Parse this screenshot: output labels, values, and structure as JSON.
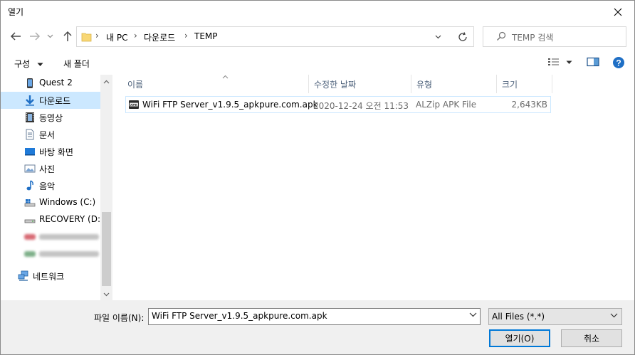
{
  "window": {
    "title": "열기"
  },
  "nav": {
    "breadcrumbs": [
      "내 PC",
      "다운로드",
      "TEMP"
    ],
    "search_placeholder": "TEMP 검색"
  },
  "toolbar": {
    "organize_label": "구성",
    "new_folder_label": "새 폴더"
  },
  "sidebar": {
    "items": [
      {
        "label": "Quest 2",
        "icon": "phone-icon"
      },
      {
        "label": "다운로드",
        "icon": "download-arrow-icon",
        "selected": true
      },
      {
        "label": "동영상",
        "icon": "video-icon"
      },
      {
        "label": "문서",
        "icon": "document-icon"
      },
      {
        "label": "바탕 화면",
        "icon": "desktop-icon"
      },
      {
        "label": "사진",
        "icon": "pictures-icon"
      },
      {
        "label": "음악",
        "icon": "music-icon"
      },
      {
        "label": "Windows (C:)",
        "icon": "drive-icon"
      },
      {
        "label": "RECOVERY (D:)",
        "icon": "drive-icon"
      },
      {
        "label": "네트워크",
        "icon": "network-icon"
      }
    ]
  },
  "columns": {
    "name": "이름",
    "modified": "수정한 날짜",
    "type": "유형",
    "size": "크기"
  },
  "files": [
    {
      "name": "WiFi FTP Server_v1.9.5_apkpure.com.apk",
      "modified": "2020-12-24 오전 11:53",
      "type": "ALZip APK File",
      "size": "2,643KB"
    }
  ],
  "bottom": {
    "filename_label": "파일 이름(N):",
    "filename_value": "WiFi FTP Server_v1.9.5_apkpure.com.apk",
    "filetype_value": "All Files (*.*)",
    "open_label": "열기(O)",
    "cancel_label": "취소"
  },
  "colors": {
    "accent": "#0078d7",
    "selection": "#cce8ff",
    "header_text": "#4c607a"
  }
}
